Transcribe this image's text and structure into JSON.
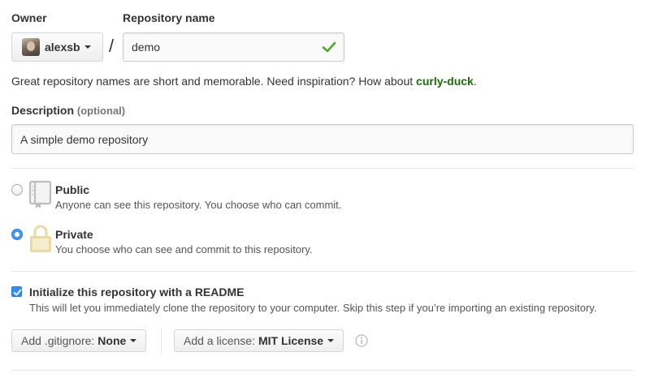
{
  "owner": {
    "label": "Owner",
    "name": "alexsb"
  },
  "repository": {
    "label": "Repository name",
    "value": "demo",
    "slash": "/"
  },
  "hint": {
    "text": "Great repository names are short and memorable. Need inspiration? How about ",
    "suggestion": "curly-duck",
    "end": "."
  },
  "description": {
    "label": "Description",
    "optional": "(optional)",
    "value": "A simple demo repository"
  },
  "visibility": {
    "public": {
      "title": "Public",
      "desc": "Anyone can see this repository. You choose who can commit.",
      "icon": "book-icon",
      "selected": false
    },
    "private": {
      "title": "Private",
      "desc": "You choose who can see and commit to this repository.",
      "icon": "lock-icon",
      "selected": true
    }
  },
  "init": {
    "checked": true,
    "title": "Initialize this repository with a README",
    "desc": "This will let you immediately clone the repository to your computer. Skip this step if you’re importing an existing repository."
  },
  "gitignore": {
    "prefix": "Add .gitignore:",
    "value": "None"
  },
  "license": {
    "prefix": "Add a license:",
    "value": "MIT License"
  },
  "colors": {
    "accent": "#4a96ea",
    "success": "#55a532",
    "suggestion": "#1e6a0a",
    "lock": "#e9d9a6"
  }
}
